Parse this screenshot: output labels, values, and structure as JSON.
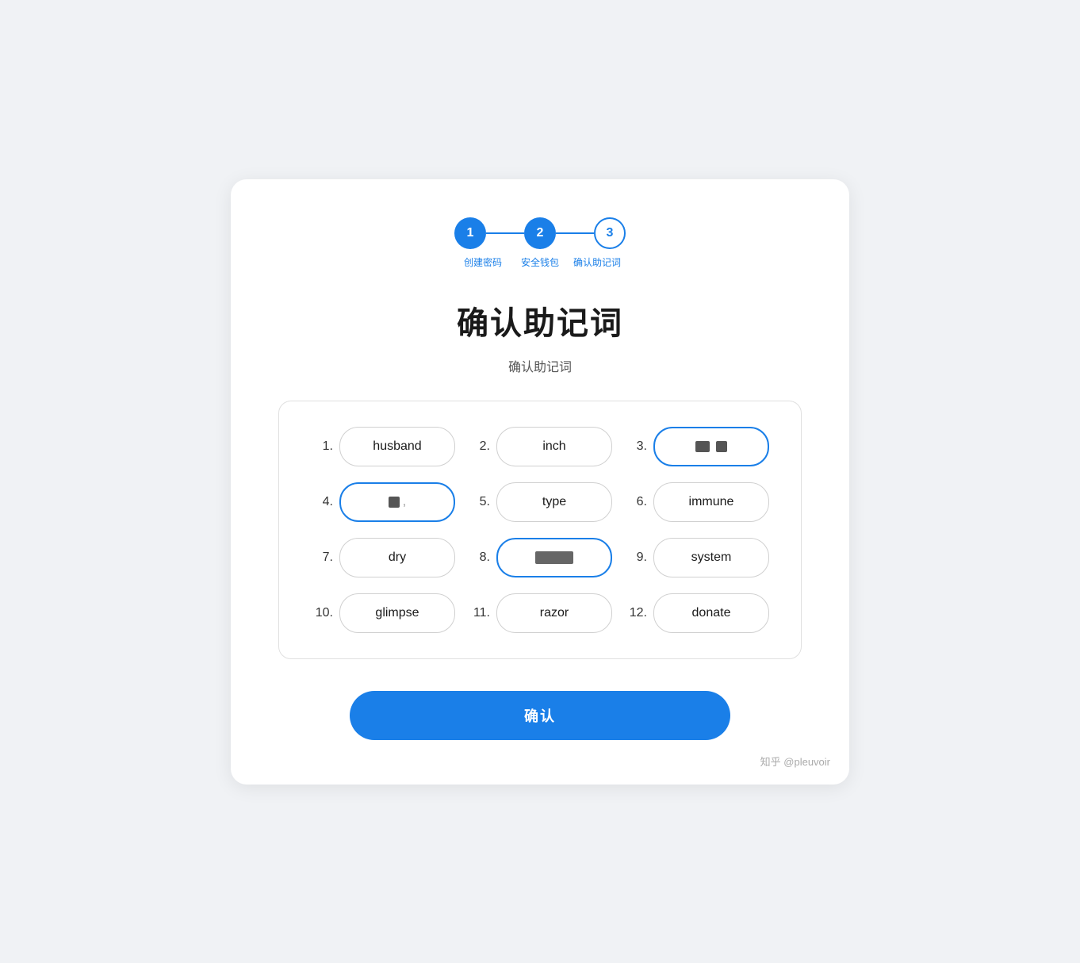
{
  "stepper": {
    "steps": [
      {
        "number": "1",
        "label": "创建密码",
        "type": "filled"
      },
      {
        "number": "2",
        "label": "安全钱包",
        "type": "filled"
      },
      {
        "number": "3",
        "label": "确认助记词",
        "type": "outlined"
      }
    ]
  },
  "page": {
    "title": "确认助记词",
    "subtitle": "确认助记词"
  },
  "mnemonics": [
    {
      "index": "1.",
      "word": "husband",
      "state": "normal"
    },
    {
      "index": "2.",
      "word": "inch",
      "state": "normal"
    },
    {
      "index": "3.",
      "word": "",
      "state": "active-blue",
      "redacted": true
    },
    {
      "index": "4.",
      "word": "",
      "state": "active-blue",
      "redacted": true
    },
    {
      "index": "5.",
      "word": "type",
      "state": "normal"
    },
    {
      "index": "6.",
      "word": "immune",
      "state": "normal"
    },
    {
      "index": "7.",
      "word": "dry",
      "state": "normal"
    },
    {
      "index": "8.",
      "word": "",
      "state": "input-active",
      "redacted": true
    },
    {
      "index": "9.",
      "word": "system",
      "state": "normal"
    },
    {
      "index": "10.",
      "word": "glimpse",
      "state": "normal"
    },
    {
      "index": "11.",
      "word": "razor",
      "state": "normal"
    },
    {
      "index": "12.",
      "word": "donate",
      "state": "normal"
    }
  ],
  "confirm_button": {
    "label": "确认"
  },
  "watermark": {
    "text": "知乎 @pleuvoir"
  }
}
